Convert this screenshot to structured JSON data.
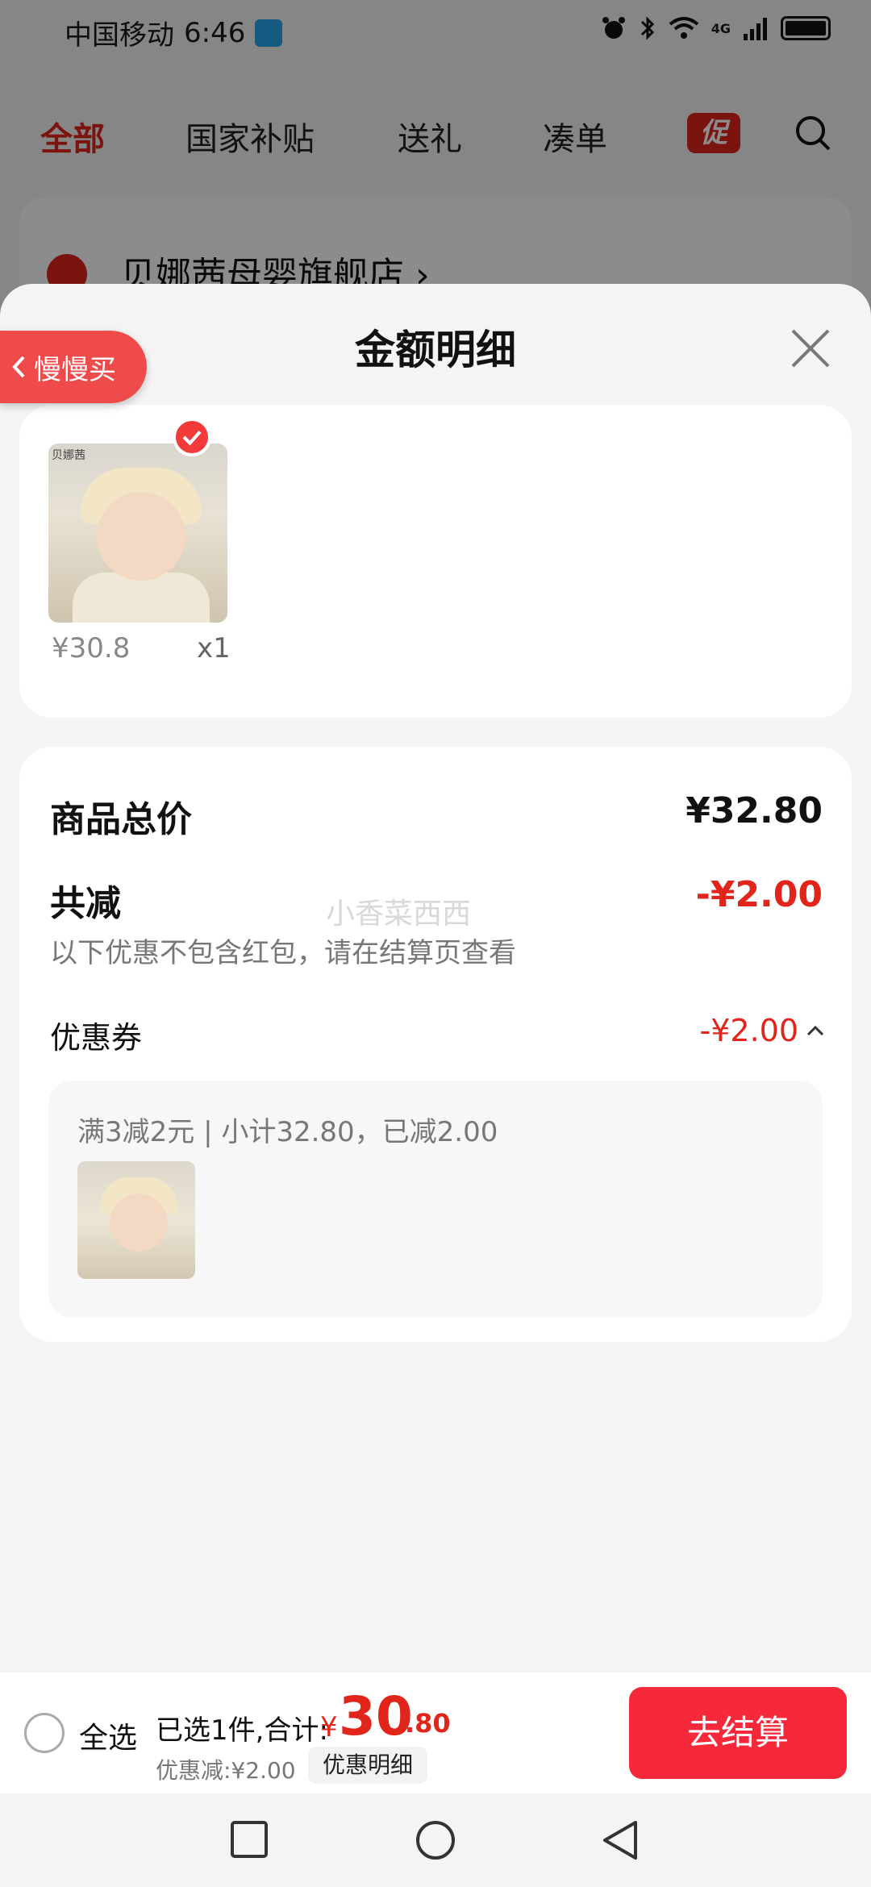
{
  "status_bar": {
    "carrier": "中国移动",
    "time": "6:46",
    "network": "4G"
  },
  "top_tabs": {
    "items": [
      "全部",
      "国家补贴",
      "送礼",
      "凑单"
    ],
    "promo": "促"
  },
  "shop": {
    "name": "贝娜茜母婴旗舰店",
    "arrow": "›"
  },
  "sheet": {
    "title": "金额明细"
  },
  "product": {
    "brand_mark": "贝娜茜",
    "price": "¥30.8",
    "quantity": "x1"
  },
  "slow_buy": {
    "label": "慢慢买"
  },
  "summary": {
    "total_label": "商品总价",
    "total_value": "¥32.80",
    "reduce_label": "共减",
    "reduce_value": "-¥2.00",
    "note": "以下优惠不包含红包，请在结算页查看",
    "watermark": "小香菜西西",
    "coupon_label": "优惠券",
    "coupon_value": "-¥2.00",
    "coupon_detail": "满3减2元 | 小计32.80，已减2.00"
  },
  "bottom_bar": {
    "select_all": "全选",
    "selected_text": "已选1件,合计:",
    "currency": "¥",
    "total_int": "30",
    "total_dec": ".80",
    "discount": "优惠减:¥2.00",
    "detail_btn": "优惠明细",
    "checkout": "去结算"
  },
  "colors": {
    "accent": "#e1251b",
    "checkout": "#f5293a"
  }
}
